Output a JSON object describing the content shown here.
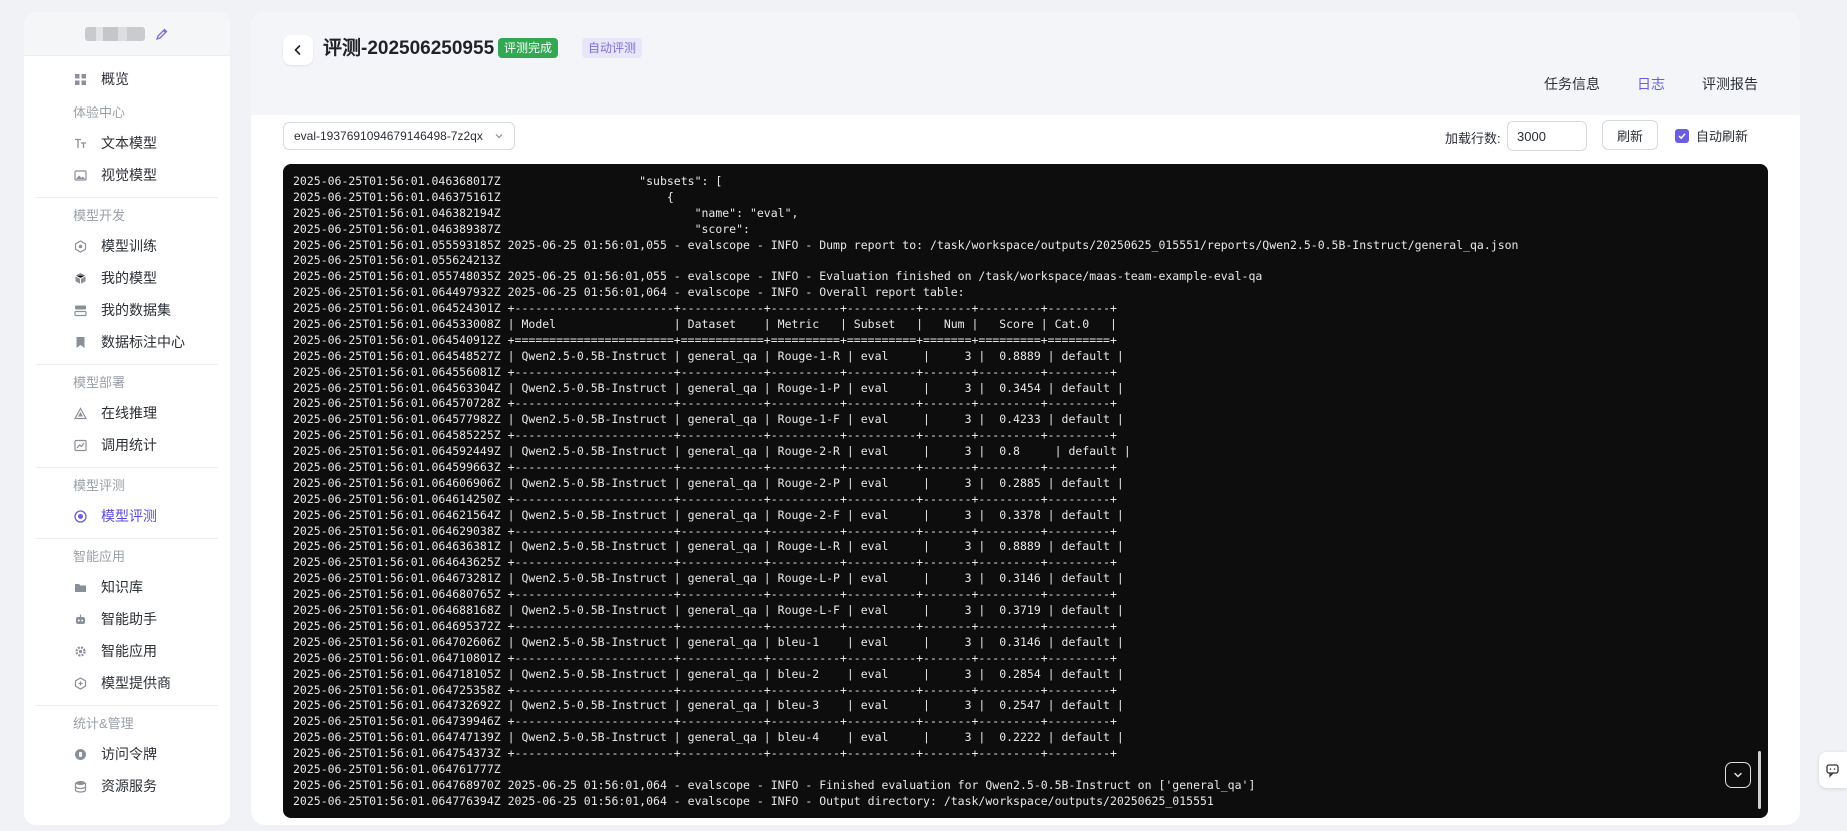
{
  "sidebar": {
    "items": [
      {
        "type": "item",
        "label": "概览",
        "icon": "grid-icon"
      },
      {
        "type": "group",
        "label": "体验中心"
      },
      {
        "type": "item",
        "label": "文本模型",
        "icon": "text-icon"
      },
      {
        "type": "item",
        "label": "视觉模型",
        "icon": "image-icon"
      },
      {
        "type": "sep"
      },
      {
        "type": "group",
        "label": "模型开发"
      },
      {
        "type": "item",
        "label": "模型训练",
        "icon": "hexagon-icon"
      },
      {
        "type": "item",
        "label": "我的模型",
        "icon": "cube-icon"
      },
      {
        "type": "item",
        "label": "我的数据集",
        "icon": "dataset-icon"
      },
      {
        "type": "item",
        "label": "数据标注中心",
        "icon": "bookmark-icon"
      },
      {
        "type": "sep"
      },
      {
        "type": "group",
        "label": "模型部署"
      },
      {
        "type": "item",
        "label": "在线推理",
        "icon": "triangle-icon"
      },
      {
        "type": "item",
        "label": "调用统计",
        "icon": "chart-icon"
      },
      {
        "type": "sep"
      },
      {
        "type": "group",
        "label": "模型评测"
      },
      {
        "type": "item",
        "label": "模型评测",
        "icon": "target-icon",
        "active": true
      },
      {
        "type": "sep"
      },
      {
        "type": "group",
        "label": "智能应用"
      },
      {
        "type": "item",
        "label": "知识库",
        "icon": "folder-icon"
      },
      {
        "type": "item",
        "label": "智能助手",
        "icon": "robot-icon"
      },
      {
        "type": "item",
        "label": "智能应用",
        "icon": "gear-icon"
      },
      {
        "type": "item",
        "label": "模型提供商",
        "icon": "provider-icon"
      },
      {
        "type": "sep"
      },
      {
        "type": "group",
        "label": "统计&管理"
      },
      {
        "type": "item",
        "label": "访问令牌",
        "icon": "token-icon"
      },
      {
        "type": "item",
        "label": "资源服务",
        "icon": "database-icon"
      }
    ]
  },
  "header": {
    "title": "评测-202506250955",
    "status_badge": "评测完成",
    "type_badge": "自动评测",
    "tabs": [
      {
        "label": "任务信息",
        "active": false
      },
      {
        "label": "日志",
        "active": true
      },
      {
        "label": "评测报告",
        "active": false
      }
    ]
  },
  "toolbar": {
    "run_select_value": "eval-1937691094679146498-7z2qx",
    "lines_label": "加载行数:",
    "lines_value": "3000",
    "refresh_label": "刷新",
    "auto_refresh_label": "自动刷新",
    "auto_refresh_checked": true
  },
  "log": {
    "lines": [
      "2025-06-25T01:56:01.046368017Z                    \"subsets\": [",
      "2025-06-25T01:56:01.046375161Z                        {",
      "2025-06-25T01:56:01.046382194Z                            \"name\": \"eval\",",
      "2025-06-25T01:56:01.046389387Z                            \"score\":",
      "2025-06-25T01:56:01.055593185Z 2025-06-25 01:56:01,055 - evalscope - INFO - Dump report to: /task/workspace/outputs/20250625_015551/reports/Qwen2.5-0.5B-Instruct/general_qa.json",
      "2025-06-25T01:56:01.055624213Z",
      "2025-06-25T01:56:01.055748035Z 2025-06-25 01:56:01,055 - evalscope - INFO - Evaluation finished on /task/workspace/maas-team-example-eval-qa",
      "2025-06-25T01:56:01.064497932Z 2025-06-25 01:56:01,064 - evalscope - INFO - Overall report table:",
      "2025-06-25T01:56:01.064524301Z +-----------------------+------------+----------+----------+-------+---------+---------+",
      "2025-06-25T01:56:01.064533008Z | Model                 | Dataset    | Metric   | Subset   |   Num |   Score | Cat.0   |",
      "2025-06-25T01:56:01.064540912Z +=======================+============+==========+==========+=======+=========+=========+",
      "2025-06-25T01:56:01.064548527Z | Qwen2.5-0.5B-Instruct | general_qa | Rouge-1-R | eval     |     3 |  0.8889 | default |",
      "2025-06-25T01:56:01.064556081Z +-----------------------+------------+----------+----------+-------+---------+---------+",
      "2025-06-25T01:56:01.064563304Z | Qwen2.5-0.5B-Instruct | general_qa | Rouge-1-P | eval     |     3 |  0.3454 | default |",
      "2025-06-25T01:56:01.064570728Z +-----------------------+------------+----------+----------+-------+---------+---------+",
      "2025-06-25T01:56:01.064577982Z | Qwen2.5-0.5B-Instruct | general_qa | Rouge-1-F | eval     |     3 |  0.4233 | default |",
      "2025-06-25T01:56:01.064585225Z +-----------------------+------------+----------+----------+-------+---------+---------+",
      "2025-06-25T01:56:01.064592449Z | Qwen2.5-0.5B-Instruct | general_qa | Rouge-2-R | eval     |     3 |  0.8     | default |",
      "2025-06-25T01:56:01.064599663Z +-----------------------+------------+----------+----------+-------+---------+---------+",
      "2025-06-25T01:56:01.064606906Z | Qwen2.5-0.5B-Instruct | general_qa | Rouge-2-P | eval     |     3 |  0.2885 | default |",
      "2025-06-25T01:56:01.064614250Z +-----------------------+------------+----------+----------+-------+---------+---------+",
      "2025-06-25T01:56:01.064621564Z | Qwen2.5-0.5B-Instruct | general_qa | Rouge-2-F | eval     |     3 |  0.3378 | default |",
      "2025-06-25T01:56:01.064629038Z +-----------------------+------------+----------+----------+-------+---------+---------+",
      "2025-06-25T01:56:01.064636381Z | Qwen2.5-0.5B-Instruct | general_qa | Rouge-L-R | eval     |     3 |  0.8889 | default |",
      "2025-06-25T01:56:01.064643625Z +-----------------------+------------+----------+----------+-------+---------+---------+",
      "2025-06-25T01:56:01.064673281Z | Qwen2.5-0.5B-Instruct | general_qa | Rouge-L-P | eval     |     3 |  0.3146 | default |",
      "2025-06-25T01:56:01.064680765Z +-----------------------+------------+----------+----------+-------+---------+---------+",
      "2025-06-25T01:56:01.064688168Z | Qwen2.5-0.5B-Instruct | general_qa | Rouge-L-F | eval     |     3 |  0.3719 | default |",
      "2025-06-25T01:56:01.064695372Z +-----------------------+------------+----------+----------+-------+---------+---------+",
      "2025-06-25T01:56:01.064702606Z | Qwen2.5-0.5B-Instruct | general_qa | bleu-1    | eval     |     3 |  0.3146 | default |",
      "2025-06-25T01:56:01.064710801Z +-----------------------+------------+----------+----------+-------+---------+---------+",
      "2025-06-25T01:56:01.064718105Z | Qwen2.5-0.5B-Instruct | general_qa | bleu-2    | eval     |     3 |  0.2854 | default |",
      "2025-06-25T01:56:01.064725358Z +-----------------------+------------+----------+----------+-------+---------+---------+",
      "2025-06-25T01:56:01.064732692Z | Qwen2.5-0.5B-Instruct | general_qa | bleu-3    | eval     |     3 |  0.2547 | default |",
      "2025-06-25T01:56:01.064739946Z +-----------------------+------------+----------+----------+-------+---------+---------+",
      "2025-06-25T01:56:01.064747139Z | Qwen2.5-0.5B-Instruct | general_qa | bleu-4    | eval     |     3 |  0.2222 | default |",
      "2025-06-25T01:56:01.064754373Z +-----------------------+------------+----------+----------+-------+---------+---------+",
      "2025-06-25T01:56:01.064761777Z",
      "2025-06-25T01:56:01.064768970Z 2025-06-25 01:56:01,064 - evalscope - INFO - Finished evaluation for Qwen2.5-0.5B-Instruct on ['general_qa']",
      "2025-06-25T01:56:01.064776394Z 2025-06-25 01:56:01,064 - evalscope - INFO - Output directory: /task/workspace/outputs/20250625_015551"
    ]
  },
  "colors": {
    "accent": "#6a5de0",
    "success": "#33a853",
    "console_bg": "#0d0d0e"
  }
}
